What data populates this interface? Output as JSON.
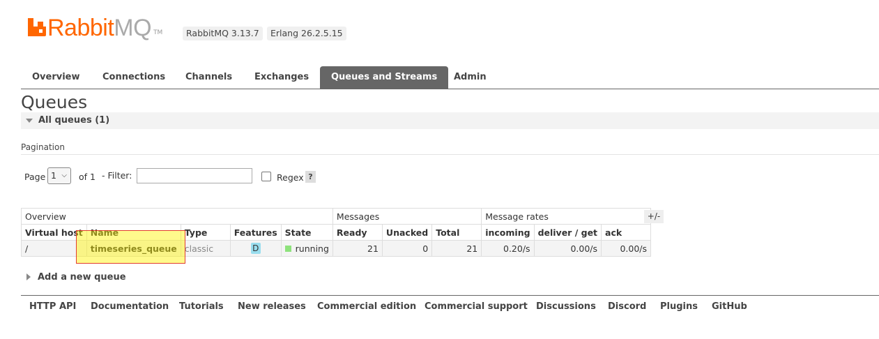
{
  "header": {
    "logo_primary": "Rabbit",
    "logo_secondary": "MQ",
    "logo_tm": "TM",
    "rabbitmq_version": "RabbitMQ 3.13.7",
    "erlang_version": "Erlang 26.2.5.15",
    "brand_color": "#ff6600"
  },
  "tabs": [
    {
      "label": "Overview",
      "active": false
    },
    {
      "label": "Connections",
      "active": false
    },
    {
      "label": "Channels",
      "active": false
    },
    {
      "label": "Exchanges",
      "active": false
    },
    {
      "label": "Queues and Streams",
      "active": true
    },
    {
      "label": "Admin",
      "active": false
    }
  ],
  "page_title": "Queues",
  "section": {
    "title": "All queues (1)",
    "expanded": true
  },
  "pagination": {
    "label": "Pagination",
    "page_label": "Page",
    "page_value": "1",
    "of_label": "of 1",
    "filter_label": "- Filter:",
    "filter_value": "",
    "regex_label": "Regex",
    "regex_checked": false,
    "help_label": "?"
  },
  "table": {
    "groups": [
      "Overview",
      "Messages",
      "Message rates"
    ],
    "columns": [
      "Virtual host",
      "Name",
      "Type",
      "Features",
      "State",
      "Ready",
      "Unacked",
      "Total",
      "incoming",
      "deliver / get",
      "ack"
    ],
    "toggle_label": "+/-",
    "rows": [
      {
        "vhost": "/",
        "name": "timeseries_queue",
        "type": "classic",
        "features": "D",
        "state": "running",
        "ready": "21",
        "unacked": "0",
        "total": "21",
        "incoming": "0.20/s",
        "deliver_get": "0.00/s",
        "ack": "0.00/s"
      }
    ]
  },
  "add_queue_label": "Add a new queue",
  "footer_links": [
    "HTTP API",
    "Documentation",
    "Tutorials",
    "New releases",
    "Commercial edition",
    "Commercial support",
    "Discussions",
    "Discord",
    "Plugins",
    "GitHub"
  ]
}
